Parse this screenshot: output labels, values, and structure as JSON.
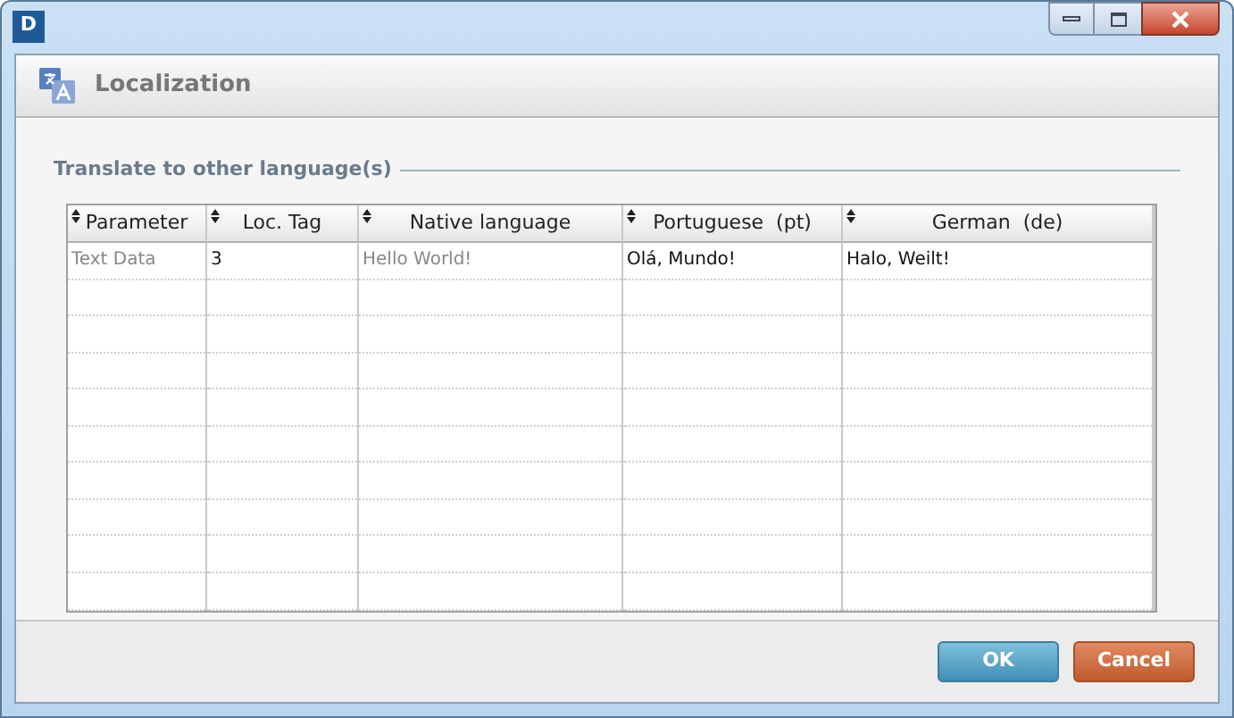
{
  "window": {
    "app_icon": "D"
  },
  "header": {
    "title": "Localization"
  },
  "group": {
    "label": "Translate to other language(s)"
  },
  "table": {
    "columns": [
      {
        "label": "Parameter"
      },
      {
        "label": "Loc. Tag"
      },
      {
        "label": "Native language"
      },
      {
        "label": "Portuguese  (pt)"
      },
      {
        "label": "German  (de)"
      }
    ],
    "rows": [
      {
        "cells": [
          {
            "text": "Text Data",
            "editable": false
          },
          {
            "text": "3",
            "editable": true
          },
          {
            "text": "Hello World!",
            "editable": false
          },
          {
            "text": "Olá, Mundo!",
            "editable": true
          },
          {
            "text": "Halo, Weilt!",
            "editable": true
          }
        ]
      }
    ]
  },
  "buttons": [
    {
      "label": "OK",
      "kind": "primary"
    },
    {
      "label": "Cancel",
      "kind": "cancel"
    }
  ]
}
